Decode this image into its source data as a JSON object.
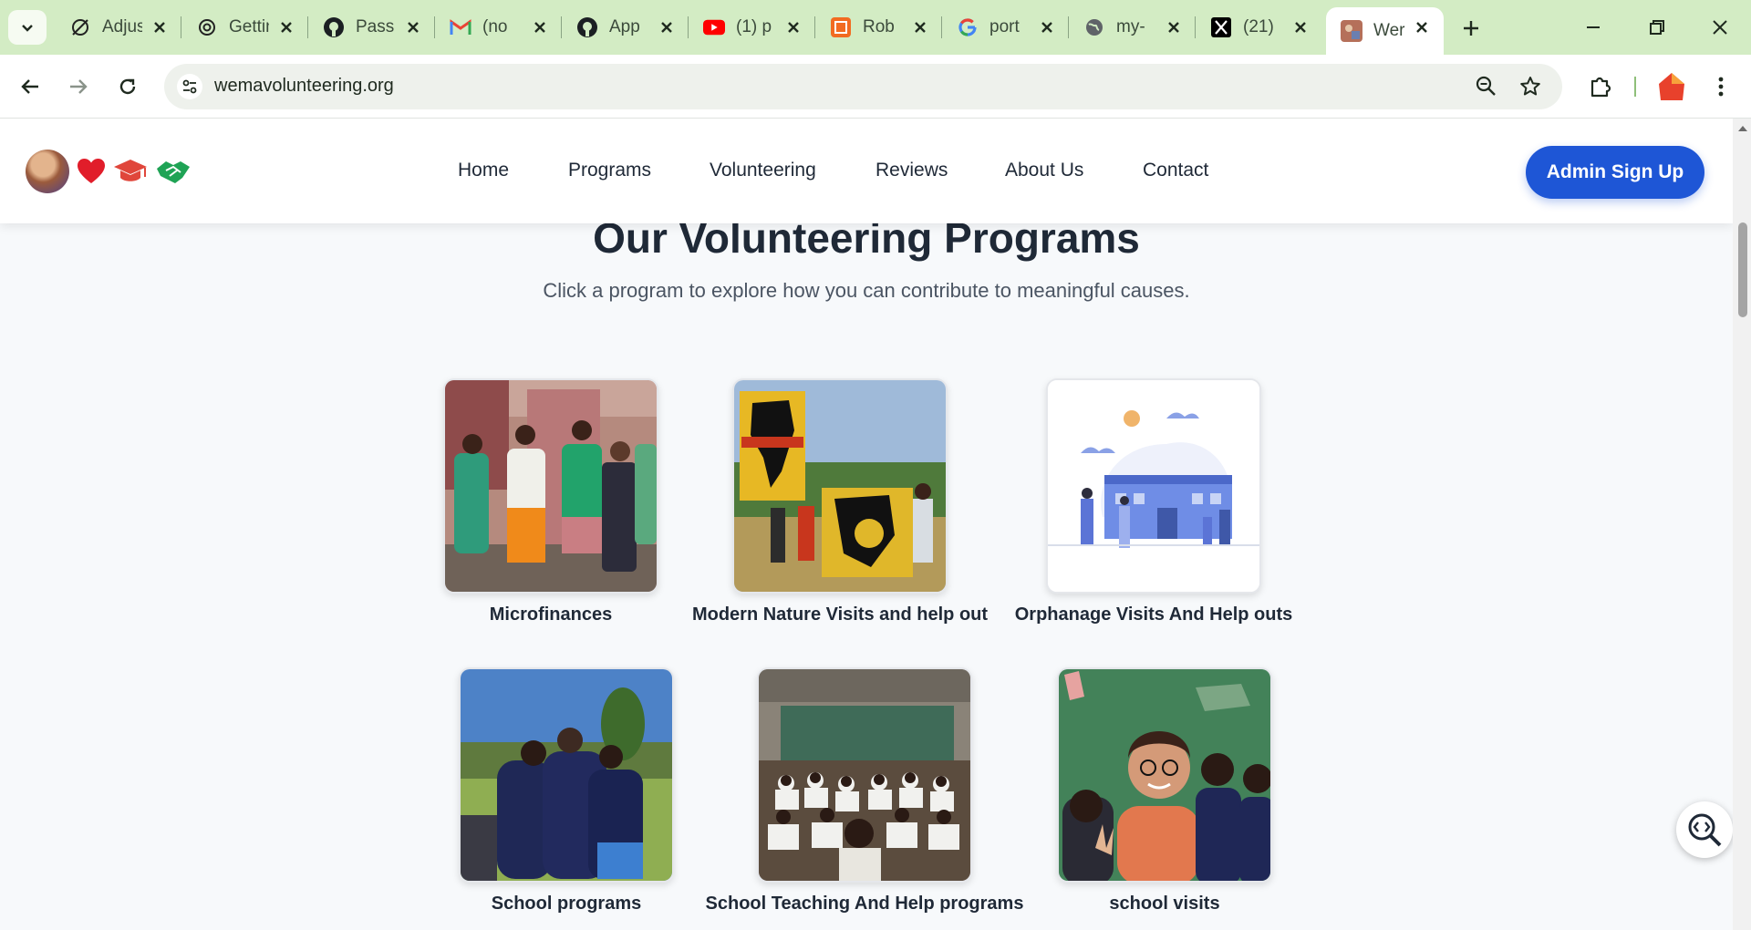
{
  "browser": {
    "tabs": [
      {
        "title": "Adjust",
        "icon": "clock-slash-icon",
        "active": false
      },
      {
        "title": "Getting",
        "icon": "openai-icon",
        "active": false
      },
      {
        "title": "Pass",
        "icon": "github-icon",
        "active": false
      },
      {
        "title": "(no",
        "icon": "gmail-icon",
        "active": false
      },
      {
        "title": "App",
        "icon": "github-icon",
        "active": false
      },
      {
        "title": "(1) p",
        "icon": "youtube-icon",
        "active": false
      },
      {
        "title": "Rob",
        "icon": "codesandbox-icon",
        "active": false
      },
      {
        "title": "port",
        "icon": "google-icon",
        "active": false
      },
      {
        "title": "my-",
        "icon": "globe-icon",
        "active": false
      },
      {
        "title": "(21)",
        "icon": "x-icon",
        "active": false
      },
      {
        "title": "Wer",
        "icon": "site-favicon-icon",
        "active": true
      }
    ],
    "url": "wemavolunteering.org"
  },
  "site": {
    "brand_icons": [
      "heart-icon",
      "graduation-cap-icon",
      "handshake-icon"
    ],
    "nav": [
      "Home",
      "Programs",
      "Volunteering",
      "Reviews",
      "About Us",
      "Contact"
    ],
    "cta": "Admin Sign Up",
    "heading": "Our Volunteering Programs",
    "subheading": "Click a program to explore how you can contribute to meaningful causes.",
    "programs": [
      {
        "title": "Microfinances"
      },
      {
        "title": "Modern Nature Visits and help out"
      },
      {
        "title": "Orphanage Visits And Help outs"
      },
      {
        "title": "School programs"
      },
      {
        "title": "School Teaching And Help programs"
      },
      {
        "title": "school visits"
      }
    ]
  },
  "colors": {
    "tabstrip": "#d3ecc4",
    "primary": "#1e56d6",
    "heart": "#e11d2a",
    "cap": "#e0463b",
    "handshake": "#1fa355"
  }
}
